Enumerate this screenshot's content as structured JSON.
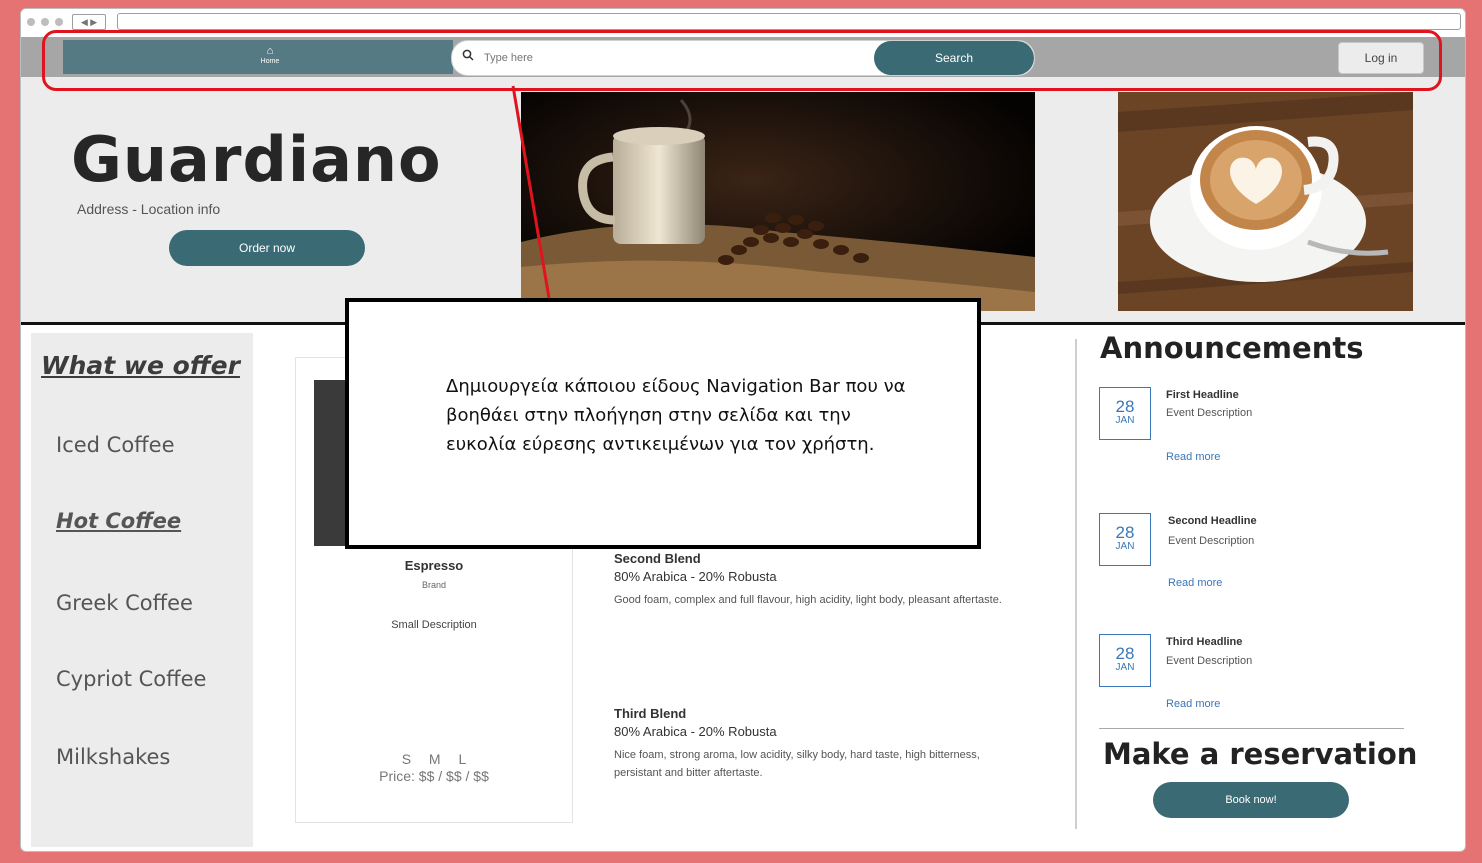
{
  "nav": {
    "home_label": "Home",
    "search_placeholder": "Type here",
    "search_button": "Search",
    "login_button": "Log in"
  },
  "hero": {
    "title": "Guardiano",
    "address": "Address - Location info",
    "order_button": "Order now"
  },
  "sidebar": {
    "title": "What we offer",
    "items": [
      {
        "label": "Iced Coffee"
      },
      {
        "label": "Hot Coffee",
        "active": true
      },
      {
        "label": "Greek Coffee"
      },
      {
        "label": "Cypriot Coffee"
      },
      {
        "label": "Milkshakes"
      }
    ]
  },
  "product": {
    "name": "Espresso",
    "brand": "Brand",
    "description": "Small Description",
    "sizes": "S M L",
    "price": "Price: $$ / $$ / $$"
  },
  "blends": [
    {
      "name": "Second Blend",
      "mix": "80% Arabica - 20% Robusta",
      "description": "Good foam, complex and full flavour, high acidity, light body, pleasant aftertaste."
    },
    {
      "name": "Third Blend",
      "mix": "80% Arabica - 20% Robusta",
      "description": "Nice foam, strong aroma, low acidity, silky body, hard taste, high bitterness, persistant and bitter aftertaste."
    }
  ],
  "announcements": {
    "title": "Announcements",
    "items": [
      {
        "day": "28",
        "month": "JAN",
        "headline": "First Headline",
        "description": "Event Description",
        "link": "Read more"
      },
      {
        "day": "28",
        "month": "JAN",
        "headline": "Second Headline",
        "description": "Event Description",
        "link": "Read more"
      },
      {
        "day": "28",
        "month": "JAN",
        "headline": "Third Headline",
        "description": "Event Description",
        "link": "Read more"
      }
    ]
  },
  "reservation": {
    "title": "Make a reservation",
    "button": "Book now!"
  },
  "annotation": {
    "text": "Δημιουργεία κάποιου είδους Navigation Bar που να βοηθάει στην πλοήγηση στην σελίδα και την ευκολία εύρεσης αντικειμένων για τον χρήστη."
  },
  "colors": {
    "page_background": "#e57373",
    "primary_button": "#3a6b75",
    "navbar": "#a6a6a6",
    "highlight": "#e0141e",
    "link": "#3a77b8"
  },
  "icons": {
    "home": "home-icon",
    "search": "search-icon"
  }
}
